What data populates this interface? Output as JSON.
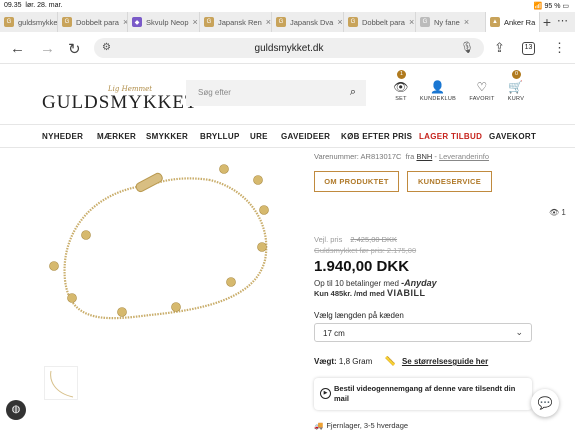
{
  "status": {
    "time": "09.35",
    "date": "lør. 28. mar.",
    "battery": "95 %"
  },
  "tabs": [
    {
      "label": "guldsmykket",
      "color": "#c8a35a",
      "glyph": "G"
    },
    {
      "label": "Dobbelt para",
      "color": "#c8a35a",
      "glyph": "G"
    },
    {
      "label": "Skvulp Neop",
      "color": "#7a5ac8",
      "glyph": "◆"
    },
    {
      "label": "Japansk Ren",
      "color": "#c8a35a",
      "glyph": "G"
    },
    {
      "label": "Japansk Dva",
      "color": "#c8a35a",
      "glyph": "G"
    },
    {
      "label": "Dobbelt para",
      "color": "#c8a35a",
      "glyph": "G"
    },
    {
      "label": "Ny fane",
      "color": "#bbbbbb",
      "glyph": "G"
    },
    {
      "label": "Anker Ra",
      "color": "#c8a35a",
      "glyph": "▲"
    }
  ],
  "url": "guldsmykket.dk",
  "tab_count": "13",
  "header": {
    "logo": "GULDSMYKKET",
    "logo_script": "Lig Hemmet",
    "search_placeholder": "Søg efter",
    "icons": [
      {
        "label": "SET",
        "icon": "eye-icon",
        "glyph": "👁",
        "badge": "1"
      },
      {
        "label": "KUNDEKLUB",
        "icon": "user-icon",
        "glyph": "👤",
        "badge": ""
      },
      {
        "label": "FAVORIT",
        "icon": "heart-icon",
        "glyph": "♡",
        "badge": ""
      },
      {
        "label": "KURV",
        "icon": "basket-icon",
        "glyph": "🛒",
        "badge": "0"
      }
    ]
  },
  "menu": [
    "NYHEDER",
    "MÆRKER",
    "SMYKKER",
    "BRYLLUP",
    "URE",
    "GAVEIDEER",
    "KØB EFTER PRIS",
    "LAGER TILBUD",
    "GAVEKORT"
  ],
  "product": {
    "varenr_label": "Varenummer: AR813017C",
    "fra": "fra",
    "brand": "BNH",
    "lev": "Leveranderinfo",
    "btn_about": "OM PRODUKTET",
    "btn_service": "KUNDESERVICE",
    "views": "1",
    "vejl_label": "Vejl. pris",
    "vejl_price": "2.425,00 DKK",
    "gm_price": "Guldsmykket før pris: 2.175,00",
    "price": "1.940,00 DKK",
    "anyday_text": "Op til 10 betalinger med",
    "anyday_brand": "-Anyday",
    "viabill_text": "Kun 485kr. /md med",
    "viabill_brand": "VIABILL",
    "length_label": "Vælg længden på kæden",
    "length_value": "17 cm",
    "weight_label": "Vægt:",
    "weight_value": "1,8 Gram",
    "size_guide": "Se størrelsesguide her",
    "video_text": "Bestil videogennemgang af denne vare tilsendt din mail",
    "stock": "Fjernlager, 3-5 hverdage"
  },
  "colors": {
    "gold": "#c08a3e",
    "sale_red": "#c6231c",
    "badge": "#b07a1e"
  }
}
